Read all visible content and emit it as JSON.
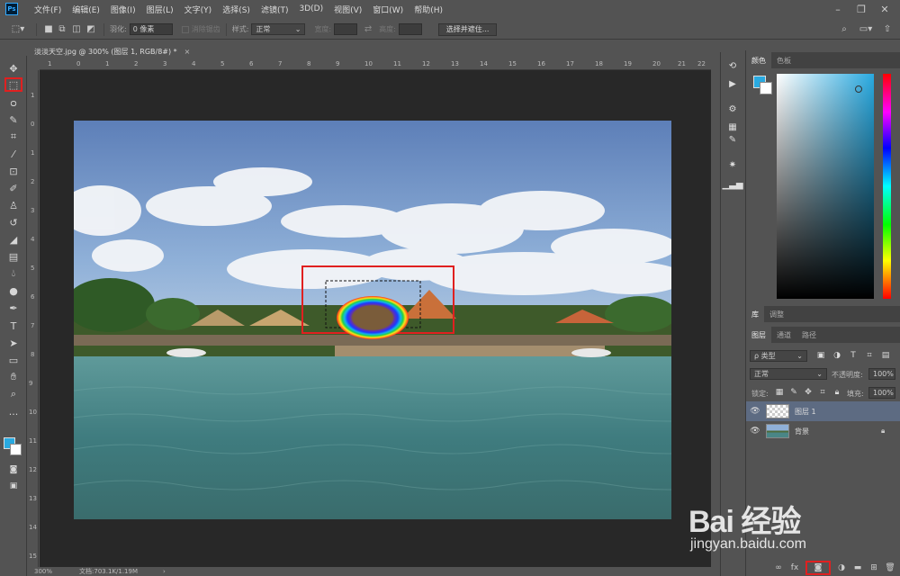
{
  "menubar": {
    "logo": "Ps",
    "items": [
      "文件(F)",
      "编辑(E)",
      "图像(I)",
      "图层(L)",
      "文字(Y)",
      "选择(S)",
      "滤镜(T)",
      "3D(D)",
      "视图(V)",
      "窗口(W)",
      "帮助(H)"
    ]
  },
  "options": {
    "feather_label": "羽化:",
    "feather_value": "0 像素",
    "antialias_label": "消除锯齿",
    "style_label": "样式:",
    "style_value": "正常",
    "width_label": "宽度:",
    "height_label": "高度:",
    "select_mask_button": "选择并遮住..."
  },
  "document": {
    "tab_title": "淡淡天空.jpg @ 300% (图层 1, RGB/8#) *",
    "close": "×",
    "zoom": "300%",
    "doc_size": "文档:703.1K/1.19M"
  },
  "rulers": {
    "top": [
      "1",
      "0",
      "1",
      "2",
      "3",
      "4",
      "5",
      "6",
      "7",
      "8",
      "9",
      "10",
      "11",
      "12",
      "13",
      "14",
      "15",
      "16",
      "17",
      "18",
      "19",
      "20",
      "21",
      "22"
    ],
    "left": [
      "1",
      "0",
      "1",
      "2",
      "3",
      "4",
      "5",
      "6",
      "7",
      "8",
      "9",
      "10",
      "11",
      "12",
      "13",
      "14",
      "15",
      "16"
    ]
  },
  "color_panel": {
    "tabs": [
      "颜色",
      "色板"
    ],
    "foreground": "#29aae1",
    "background": "#ffffff"
  },
  "library_panel": {
    "tabs": [
      "库",
      "调整"
    ]
  },
  "layers_panel": {
    "tabs": [
      "图层",
      "通道",
      "路径"
    ],
    "filter_kind": "ρ 类型",
    "blend_mode": "正常",
    "opacity_label": "不透明度:",
    "opacity_value": "100%",
    "lock_label": "锁定:",
    "fill_label": "填充:",
    "fill_value": "100%",
    "layers": [
      {
        "name": "图层 1",
        "selected": true
      },
      {
        "name": "背景",
        "selected": false
      }
    ]
  },
  "watermark": {
    "main": "Bai 经验",
    "sub": "jingyan.baidu.com"
  }
}
